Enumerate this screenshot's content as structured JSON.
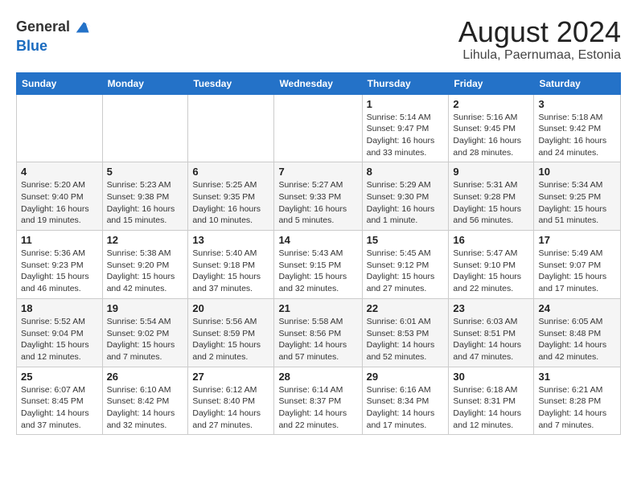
{
  "header": {
    "logo_line1": "General",
    "logo_line2": "Blue",
    "title": "August 2024",
    "subtitle": "Lihula, Paernumaa, Estonia"
  },
  "calendar": {
    "days_of_week": [
      "Sunday",
      "Monday",
      "Tuesday",
      "Wednesday",
      "Thursday",
      "Friday",
      "Saturday"
    ],
    "weeks": [
      [
        {
          "day": "",
          "info": ""
        },
        {
          "day": "",
          "info": ""
        },
        {
          "day": "",
          "info": ""
        },
        {
          "day": "",
          "info": ""
        },
        {
          "day": "1",
          "info": "Sunrise: 5:14 AM\nSunset: 9:47 PM\nDaylight: 16 hours\nand 33 minutes."
        },
        {
          "day": "2",
          "info": "Sunrise: 5:16 AM\nSunset: 9:45 PM\nDaylight: 16 hours\nand 28 minutes."
        },
        {
          "day": "3",
          "info": "Sunrise: 5:18 AM\nSunset: 9:42 PM\nDaylight: 16 hours\nand 24 minutes."
        }
      ],
      [
        {
          "day": "4",
          "info": "Sunrise: 5:20 AM\nSunset: 9:40 PM\nDaylight: 16 hours\nand 19 minutes."
        },
        {
          "day": "5",
          "info": "Sunrise: 5:23 AM\nSunset: 9:38 PM\nDaylight: 16 hours\nand 15 minutes."
        },
        {
          "day": "6",
          "info": "Sunrise: 5:25 AM\nSunset: 9:35 PM\nDaylight: 16 hours\nand 10 minutes."
        },
        {
          "day": "7",
          "info": "Sunrise: 5:27 AM\nSunset: 9:33 PM\nDaylight: 16 hours\nand 5 minutes."
        },
        {
          "day": "8",
          "info": "Sunrise: 5:29 AM\nSunset: 9:30 PM\nDaylight: 16 hours\nand 1 minute."
        },
        {
          "day": "9",
          "info": "Sunrise: 5:31 AM\nSunset: 9:28 PM\nDaylight: 15 hours\nand 56 minutes."
        },
        {
          "day": "10",
          "info": "Sunrise: 5:34 AM\nSunset: 9:25 PM\nDaylight: 15 hours\nand 51 minutes."
        }
      ],
      [
        {
          "day": "11",
          "info": "Sunrise: 5:36 AM\nSunset: 9:23 PM\nDaylight: 15 hours\nand 46 minutes."
        },
        {
          "day": "12",
          "info": "Sunrise: 5:38 AM\nSunset: 9:20 PM\nDaylight: 15 hours\nand 42 minutes."
        },
        {
          "day": "13",
          "info": "Sunrise: 5:40 AM\nSunset: 9:18 PM\nDaylight: 15 hours\nand 37 minutes."
        },
        {
          "day": "14",
          "info": "Sunrise: 5:43 AM\nSunset: 9:15 PM\nDaylight: 15 hours\nand 32 minutes."
        },
        {
          "day": "15",
          "info": "Sunrise: 5:45 AM\nSunset: 9:12 PM\nDaylight: 15 hours\nand 27 minutes."
        },
        {
          "day": "16",
          "info": "Sunrise: 5:47 AM\nSunset: 9:10 PM\nDaylight: 15 hours\nand 22 minutes."
        },
        {
          "day": "17",
          "info": "Sunrise: 5:49 AM\nSunset: 9:07 PM\nDaylight: 15 hours\nand 17 minutes."
        }
      ],
      [
        {
          "day": "18",
          "info": "Sunrise: 5:52 AM\nSunset: 9:04 PM\nDaylight: 15 hours\nand 12 minutes."
        },
        {
          "day": "19",
          "info": "Sunrise: 5:54 AM\nSunset: 9:02 PM\nDaylight: 15 hours\nand 7 minutes."
        },
        {
          "day": "20",
          "info": "Sunrise: 5:56 AM\nSunset: 8:59 PM\nDaylight: 15 hours\nand 2 minutes."
        },
        {
          "day": "21",
          "info": "Sunrise: 5:58 AM\nSunset: 8:56 PM\nDaylight: 14 hours\nand 57 minutes."
        },
        {
          "day": "22",
          "info": "Sunrise: 6:01 AM\nSunset: 8:53 PM\nDaylight: 14 hours\nand 52 minutes."
        },
        {
          "day": "23",
          "info": "Sunrise: 6:03 AM\nSunset: 8:51 PM\nDaylight: 14 hours\nand 47 minutes."
        },
        {
          "day": "24",
          "info": "Sunrise: 6:05 AM\nSunset: 8:48 PM\nDaylight: 14 hours\nand 42 minutes."
        }
      ],
      [
        {
          "day": "25",
          "info": "Sunrise: 6:07 AM\nSunset: 8:45 PM\nDaylight: 14 hours\nand 37 minutes."
        },
        {
          "day": "26",
          "info": "Sunrise: 6:10 AM\nSunset: 8:42 PM\nDaylight: 14 hours\nand 32 minutes."
        },
        {
          "day": "27",
          "info": "Sunrise: 6:12 AM\nSunset: 8:40 PM\nDaylight: 14 hours\nand 27 minutes."
        },
        {
          "day": "28",
          "info": "Sunrise: 6:14 AM\nSunset: 8:37 PM\nDaylight: 14 hours\nand 22 minutes."
        },
        {
          "day": "29",
          "info": "Sunrise: 6:16 AM\nSunset: 8:34 PM\nDaylight: 14 hours\nand 17 minutes."
        },
        {
          "day": "30",
          "info": "Sunrise: 6:18 AM\nSunset: 8:31 PM\nDaylight: 14 hours\nand 12 minutes."
        },
        {
          "day": "31",
          "info": "Sunrise: 6:21 AM\nSunset: 8:28 PM\nDaylight: 14 hours\nand 7 minutes."
        }
      ]
    ]
  }
}
